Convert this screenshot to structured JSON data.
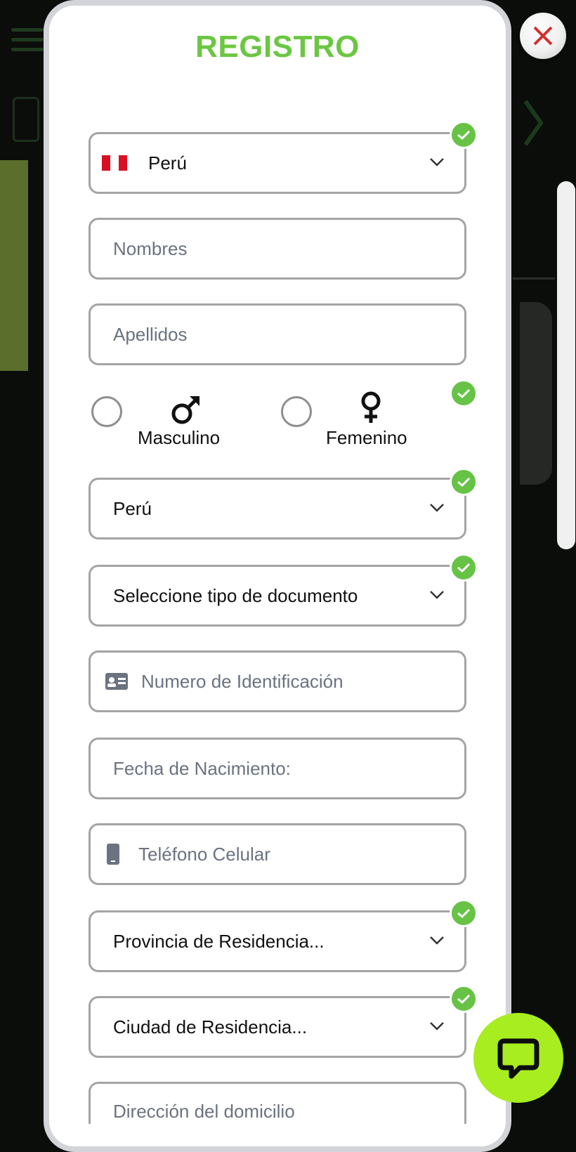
{
  "modal": {
    "title": "REGISTRO",
    "country_select": {
      "value": "Perú",
      "flag_colors": [
        "#d91023",
        "#ffffff",
        "#d91023"
      ]
    },
    "nombres": {
      "placeholder": "Nombres"
    },
    "apellidos": {
      "placeholder": "Apellidos"
    },
    "gender": {
      "male_label": "Masculino",
      "female_label": "Femenino"
    },
    "nationality_select": {
      "value": "Perú"
    },
    "document_type_select": {
      "value": "Seleccione tipo de documento"
    },
    "id_number": {
      "placeholder": "Numero de Identificación",
      "icon": "id-card-icon"
    },
    "birth_date": {
      "placeholder": "Fecha de Nacimiento:"
    },
    "phone": {
      "placeholder": "Teléfono Celular",
      "icon": "mobile-phone-icon"
    },
    "province_select": {
      "value": "Provincia de Residencia..."
    },
    "city_select": {
      "value": "Ciudad de Residencia..."
    },
    "address": {
      "placeholder": "Dirección del domicilio"
    }
  },
  "colors": {
    "accent": "#6bc742",
    "check": "#66c346",
    "chat": "#a8ed1f",
    "close_x": "#d32f2f"
  },
  "icons": {
    "close": "close-icon",
    "chat": "chat-icon",
    "check": "check-icon",
    "chevron": "chevron-down-icon"
  }
}
